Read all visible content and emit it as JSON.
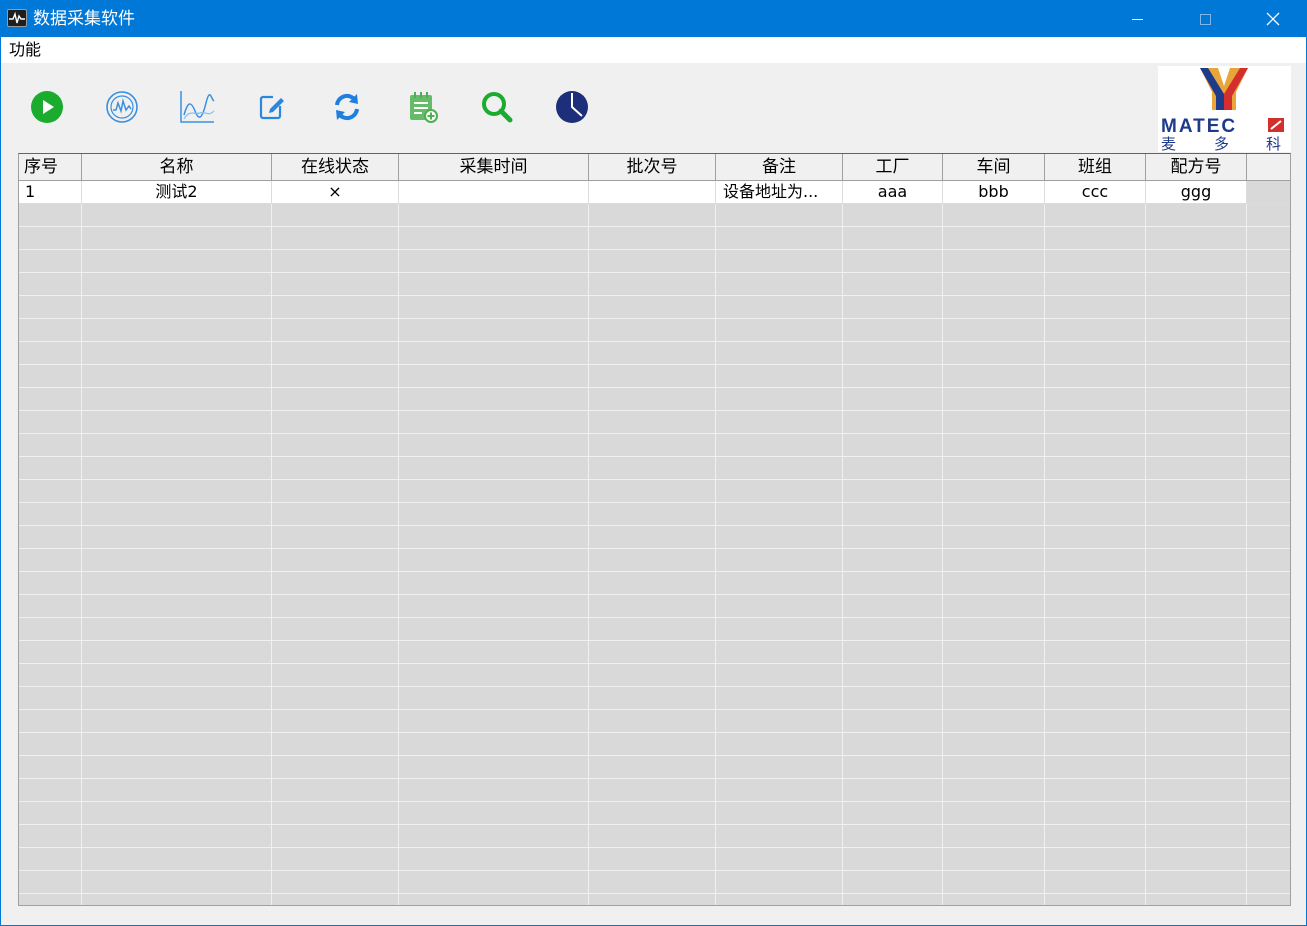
{
  "window": {
    "title": "数据采集软件"
  },
  "menu": {
    "items": [
      {
        "label": "功能"
      }
    ]
  },
  "toolbar": {
    "buttons": [
      {
        "icon": "play-icon",
        "color": "#1aab2f"
      },
      {
        "icon": "monitor-wave-icon",
        "color": "#3a8fe0"
      },
      {
        "icon": "line-chart-icon",
        "color": "#3a8fe0"
      },
      {
        "icon": "edit-icon",
        "color": "#2b86de"
      },
      {
        "icon": "refresh-icon",
        "color": "#1f7fe0"
      },
      {
        "icon": "notepad-add-icon",
        "color": "#4caf50"
      },
      {
        "icon": "search-icon",
        "color": "#1aab2f"
      },
      {
        "icon": "pie-chart-icon",
        "color": "#1d2f7a"
      }
    ]
  },
  "logo": {
    "brand": "MATEC",
    "chars": [
      "麦",
      "多",
      "科"
    ],
    "colors": {
      "y_left": "#1e3a8a",
      "y_right": "#d32f2f",
      "y_fill": "#e8a53a",
      "text": "#1e3a8a",
      "square": "#d32f2f"
    }
  },
  "table": {
    "columns": [
      "序号",
      "名称",
      "在线状态",
      "采集时间",
      "批次号",
      "备注",
      "工厂",
      "车间",
      "班组",
      "配方号"
    ],
    "rows": [
      {
        "index": "1",
        "name": "测试2",
        "status": "×",
        "time": "",
        "batch": "",
        "remark": "设备地址为...",
        "factory": "aaa",
        "workshop": "bbb",
        "team": "ccc",
        "recipe": "ggg"
      }
    ]
  }
}
